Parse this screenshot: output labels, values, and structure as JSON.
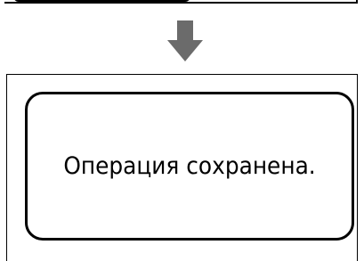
{
  "dialog": {
    "message": "Операция сохранена."
  },
  "colors": {
    "frame": "#000000",
    "arrow": "#6b6b6b",
    "background": "#ffffff"
  },
  "icons": {
    "transition": "arrow-down-icon"
  }
}
